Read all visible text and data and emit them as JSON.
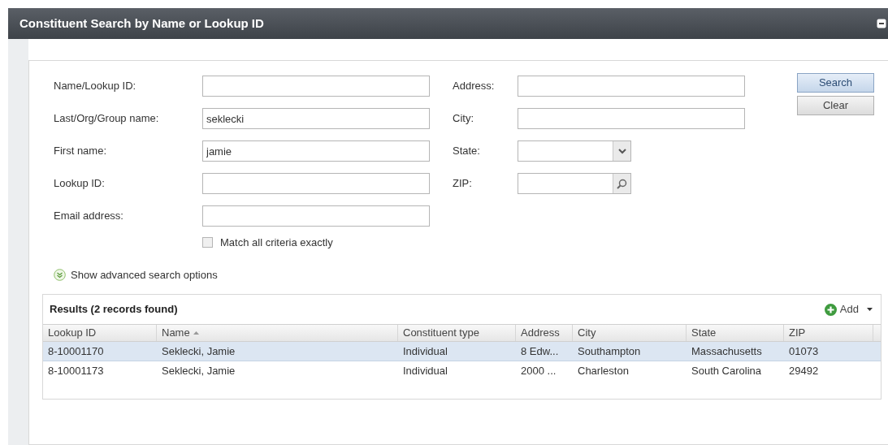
{
  "window": {
    "title": "Constituent Search by Name or Lookup ID"
  },
  "form": {
    "left_fields": [
      {
        "label": "Name/Lookup ID:"
      },
      {
        "label": "Last/Org/Group name:",
        "value": "seklecki"
      },
      {
        "label": "First name:",
        "value": "jamie"
      },
      {
        "label": "Lookup ID:"
      },
      {
        "label": "Email address:"
      }
    ],
    "right_fields": [
      {
        "label": "Address:",
        "kind": "text"
      },
      {
        "label": "City:",
        "kind": "text"
      },
      {
        "label": "State:",
        "kind": "select"
      },
      {
        "label": "ZIP:",
        "kind": "lookup"
      }
    ],
    "match_exactly": {
      "label": "Match all criteria exactly",
      "checked": false
    },
    "advanced_link": "Show advanced search options",
    "buttons": [
      "Search",
      "Clear"
    ]
  },
  "results": {
    "title": "Results (2 records found)",
    "add_button": "Add",
    "columns": [
      {
        "label": "Lookup ID",
        "sorted": false
      },
      {
        "label": "Name",
        "sorted": true
      },
      {
        "label": "Constituent type",
        "sorted": false
      },
      {
        "label": "Address",
        "sorted": false
      },
      {
        "label": "City",
        "sorted": false
      },
      {
        "label": "State",
        "sorted": false
      },
      {
        "label": "ZIP",
        "sorted": false
      }
    ],
    "rows": [
      {
        "selected": true,
        "cells": [
          "8-10001170",
          "Seklecki, Jamie",
          "Individual",
          "8 Edw...",
          "Southampton",
          "Massachusetts",
          "01073"
        ]
      },
      {
        "selected": false,
        "cells": [
          "8-10001173",
          "Seklecki, Jamie",
          "Individual",
          "2000 ...",
          "Charleston",
          "South Carolina",
          "29492"
        ]
      }
    ]
  }
}
